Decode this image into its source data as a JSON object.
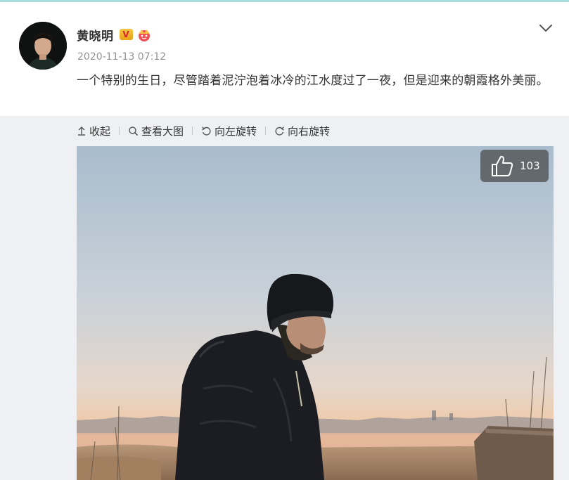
{
  "post": {
    "username": "黄晓明",
    "verified_badge": "V",
    "timestamp": "2020-11-13 07:12",
    "content": "一个特别的生日，尽管踏着泥泞泡着冰冷的江水度过了一夜，但是迎来的朝霞格外美丽。"
  },
  "toolbar": {
    "collapse_label": "收起",
    "view_large_label": "查看大图",
    "rotate_left_label": "向左旋转",
    "rotate_right_label": "向右旋转"
  },
  "image": {
    "like_count": "103"
  },
  "icons": {
    "collapse": "chevron-down-icon",
    "up_arrow": "up-arrow-icon",
    "magnifier": "search-icon",
    "rotate_left": "rotate-left-icon",
    "rotate_right": "rotate-right-icon",
    "like": "thumbs-up-icon",
    "crown": "crown-icon"
  },
  "colors": {
    "badge_gold": "#e8a317",
    "badge_red": "#d4262b",
    "time_gray": "#939393",
    "page_background": "#eff0f3"
  }
}
